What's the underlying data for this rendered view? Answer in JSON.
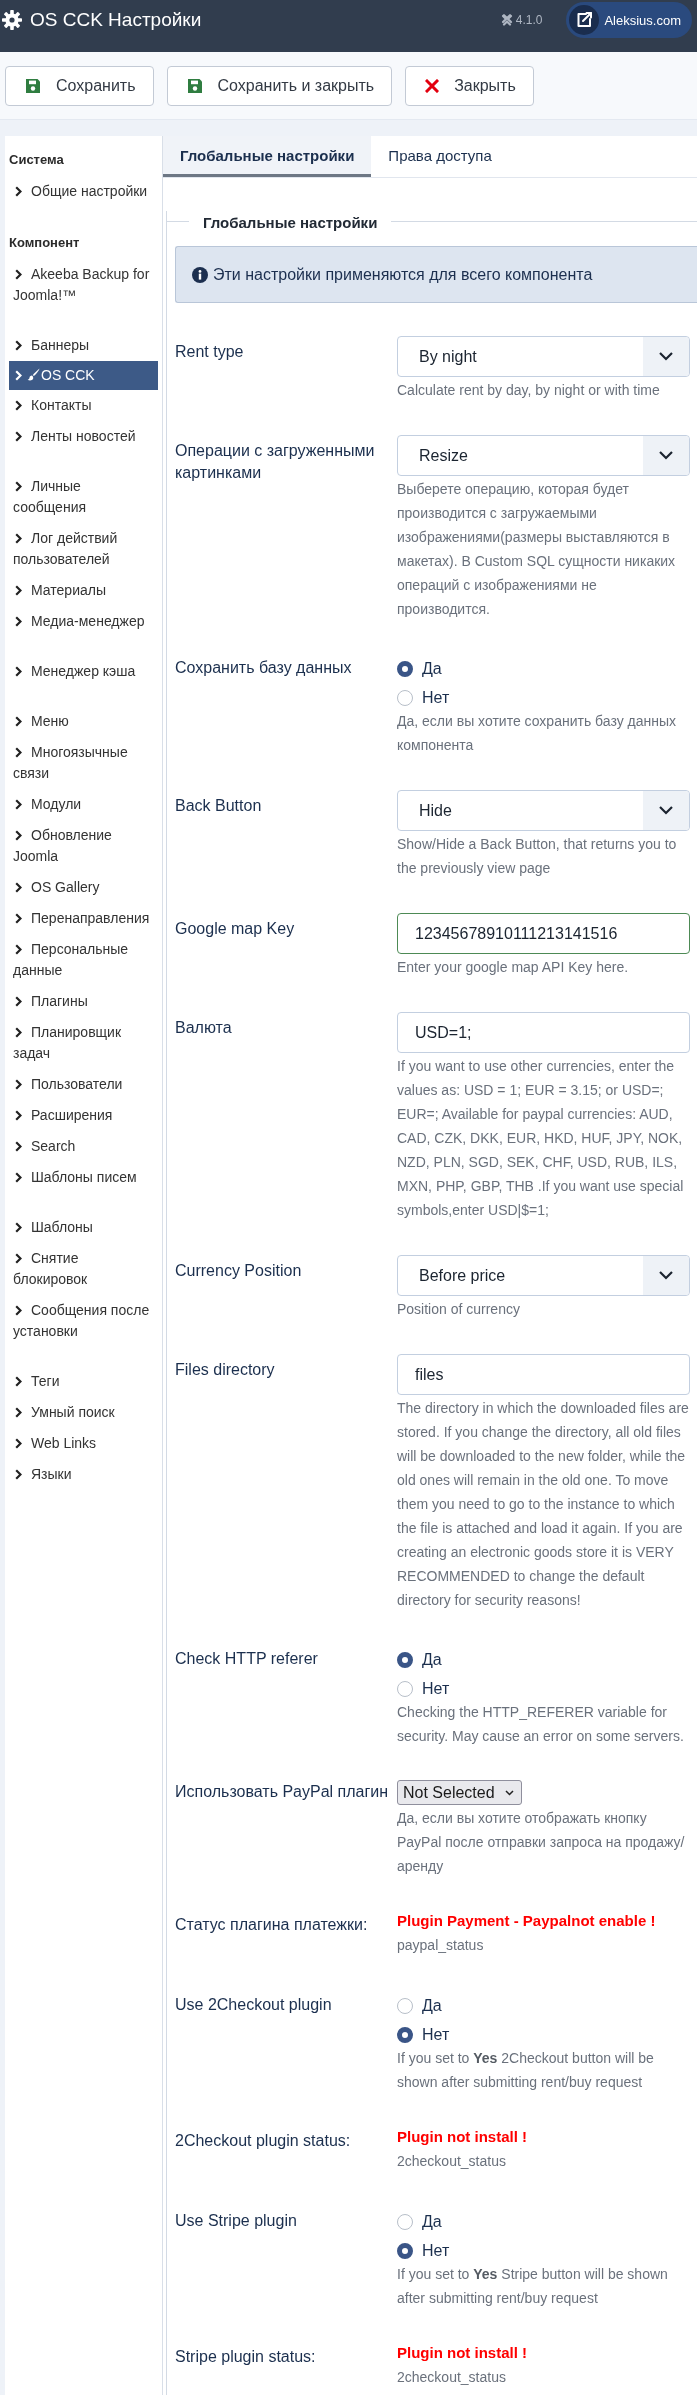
{
  "header": {
    "title": "OS CCK Настройки",
    "version": "4.1.0",
    "site_button": "Aleksius.com"
  },
  "toolbar": {
    "buttons": [
      {
        "label": "Сохранить",
        "kind": "save"
      },
      {
        "label": "Сохранить и закрыть",
        "kind": "save"
      },
      {
        "label": "Закрыть",
        "kind": "close"
      }
    ]
  },
  "sidebar": {
    "sections": [
      {
        "title": "Система",
        "groups": [
          {
            "items": [
              {
                "label": "Общие настройки",
                "selected": false
              }
            ]
          }
        ]
      },
      {
        "title": "Компонент",
        "groups": [
          {
            "items": [
              {
                "label": "Akeeba Backup for Joomla!™",
                "selected": false
              }
            ]
          },
          {
            "items": [
              {
                "label": "Баннеры",
                "selected": false
              },
              {
                "label": "OS CCK",
                "selected": true
              },
              {
                "label": "Контакты",
                "selected": false
              },
              {
                "label": "Ленты новостей",
                "selected": false
              }
            ]
          },
          {
            "items": [
              {
                "label": "Личные сообщения",
                "selected": false
              },
              {
                "label": "Лог действий пользователей",
                "selected": false
              },
              {
                "label": "Материалы",
                "selected": false
              },
              {
                "label": "Медиа-менеджер",
                "selected": false
              }
            ]
          },
          {
            "items": [
              {
                "label": "Менеджер кэша",
                "selected": false
              }
            ]
          },
          {
            "items": [
              {
                "label": "Меню",
                "selected": false
              },
              {
                "label": "Многоязычные связи",
                "selected": false
              },
              {
                "label": "Модули",
                "selected": false
              },
              {
                "label": "Обновление Joomla",
                "selected": false
              },
              {
                "label": "OS Gallery",
                "selected": false
              },
              {
                "label": "Перенаправления",
                "selected": false
              },
              {
                "label": "Персональные данные",
                "selected": false
              },
              {
                "label": "Плагины",
                "selected": false
              },
              {
                "label": "Планировщик задач",
                "selected": false
              },
              {
                "label": "Пользователи",
                "selected": false
              },
              {
                "label": "Расширения",
                "selected": false
              },
              {
                "label": "Search",
                "selected": false
              },
              {
                "label": "Шаблоны писем",
                "selected": false
              }
            ]
          },
          {
            "items": [
              {
                "label": "Шаблоны",
                "selected": false
              },
              {
                "label": "Снятие блокировок",
                "selected": false
              },
              {
                "label": "Сообщения после установки",
                "selected": false
              }
            ]
          },
          {
            "items": [
              {
                "label": "Теги",
                "selected": false
              },
              {
                "label": "Умный поиск",
                "selected": false
              },
              {
                "label": "Web Links",
                "selected": false
              },
              {
                "label": "Языки",
                "selected": false
              }
            ]
          }
        ]
      }
    ]
  },
  "tabs": [
    {
      "label": "Глобальные настройки",
      "selected": true
    },
    {
      "label": "Права доступа",
      "selected": false
    }
  ],
  "fieldset": {
    "legend": "Глобальные настройки",
    "alert": "Эти настройки применяются для всего компонента",
    "fields": [
      {
        "kind": "select",
        "label": "Rent type",
        "value": "By night",
        "description": "Calculate rent by day, by night or with time"
      },
      {
        "kind": "select",
        "label": "Операции с загруженными картинками",
        "value": "Resize",
        "description": "Выберете операцию, которая будет производится с загружаемыми изображениями(размеры выставляются в макетах). В Custom SQL сущности никаких операций с изображениями не производится."
      },
      {
        "kind": "radio",
        "label": "Сохранить базу данных",
        "options": [
          {
            "label": "Да",
            "selected": true
          },
          {
            "label": "Нет",
            "selected": false
          }
        ],
        "description": "Да, если вы хотите сохранить базу данных компонента"
      },
      {
        "kind": "select",
        "label": "Back Button",
        "value": "Hide",
        "description": "Show/Hide a Back Button, that returns you to the previously view page"
      },
      {
        "kind": "text",
        "label": "Google map Key",
        "value": "12345678910111213141516",
        "valid": true,
        "description": "Enter your google map API Key here."
      },
      {
        "kind": "text",
        "label": "Валюта",
        "value": "USD=1;",
        "valid": false,
        "description": "If you want to use other currencies, enter the values as: USD = 1; EUR = 3.15; or USD=; EUR=; Available for paypal currencies: AUD, CAD, CZK, DKK, EUR, HKD, HUF, JPY, NOK, NZD, PLN, SGD, SEK, CHF, USD, RUB, ILS, MXN, PHP, GBP, THB .If you want use special symbols,enter USD|$=1;"
      },
      {
        "kind": "select",
        "label": "Currency Position",
        "value": "Before price",
        "description": "Position of currency"
      },
      {
        "kind": "text",
        "label": "Files directory",
        "value": "files",
        "valid": false,
        "description": "The directory in which the downloaded files are stored. If you change the directory, all old files will be downloaded to the new folder, while the old ones will remain in the old one. To move them you need to go to the instance to which the file is attached and load it again. If you are creating an electronic goods store it is VERY RECOMMENDED to change the default directory for security reasons!"
      },
      {
        "kind": "radio",
        "label": "Check HTTP referer",
        "options": [
          {
            "label": "Да",
            "selected": true
          },
          {
            "label": "Нет",
            "selected": false
          }
        ],
        "description": "Checking the HTTP_REFERER variable for security. May cause an error on some servers."
      },
      {
        "kind": "native_select",
        "label": "Использовать PayPal плагин",
        "value": "Not Selected",
        "description": "Да, если вы хотите отображать кнопку PayPal после отправки запроса на продажу/аренду"
      },
      {
        "kind": "status",
        "label": "Статус плагина платежки:",
        "status": "Plugin Payment - Paypalnot enable !",
        "description": "paypal_status"
      },
      {
        "kind": "radio",
        "label": "Use 2Checkout plugin",
        "options": [
          {
            "label": "Да",
            "selected": false
          },
          {
            "label": "Нет",
            "selected": true
          }
        ],
        "description": "If you set to **Yes** 2Checkout button will be shown after submitting rent/buy request"
      },
      {
        "kind": "status",
        "label": "2Checkout plugin status:",
        "status": "Plugin not install !",
        "description": "2checkout_status"
      },
      {
        "kind": "radio",
        "label": "Use Stripe plugin",
        "options": [
          {
            "label": "Да",
            "selected": false
          },
          {
            "label": "Нет",
            "selected": true
          }
        ],
        "description": "If you set to **Yes** Stripe button will be shown after submitting rent/buy request"
      },
      {
        "kind": "status",
        "label": "Stripe plugin status:",
        "status": "Plugin not install !",
        "description": "2checkout_status"
      }
    ]
  }
}
